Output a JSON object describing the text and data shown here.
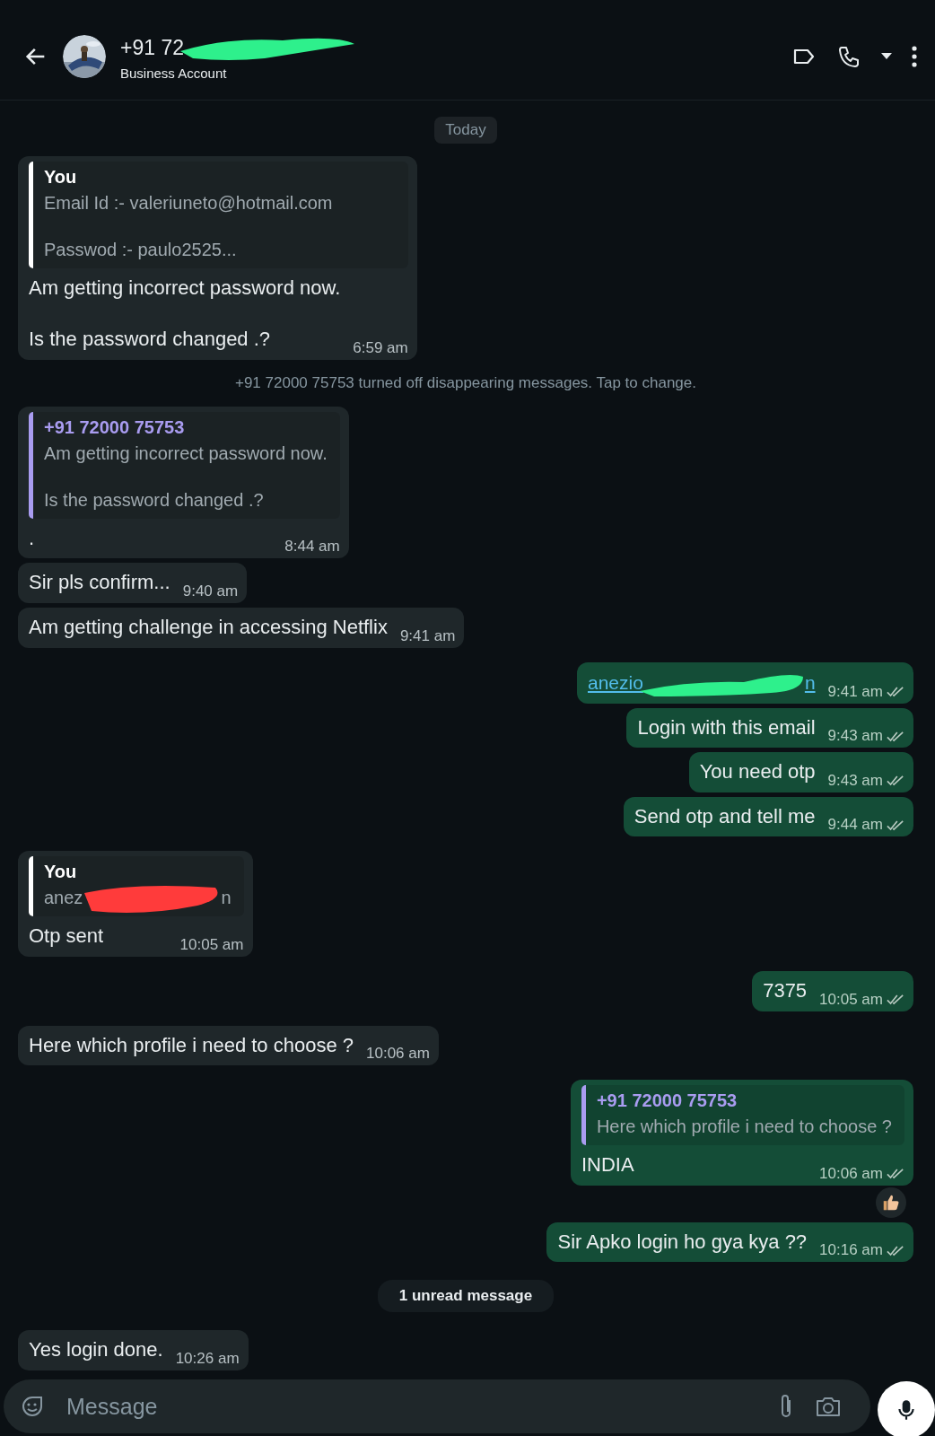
{
  "header": {
    "name_visible": "+91 72",
    "redacted": true,
    "subtitle": "Business Account"
  },
  "items": [
    {
      "kind": "date",
      "text": "Today"
    },
    {
      "kind": "message",
      "outgoing": false,
      "quote": {
        "author": "You",
        "color": "#ffffff",
        "text": "Email Id :- valeriuneto@hotmail.com\n\nPasswod :- paulo2525..."
      },
      "text": "Am getting incorrect password now.\n\nIs the password changed .?",
      "time": "6:59 am"
    },
    {
      "kind": "system",
      "text": "+91 72000 75753 turned off disappearing messages. Tap to change."
    },
    {
      "kind": "message",
      "outgoing": false,
      "quote": {
        "author": "+91 72000 75753",
        "color": "#a99cf0",
        "text": "Am getting incorrect password now.\n\nIs the password changed .?"
      },
      "text": ".",
      "time": "8:44 am"
    },
    {
      "kind": "message",
      "outgoing": false,
      "text": "Sir pls confirm...",
      "time": "9:40 am"
    },
    {
      "kind": "message",
      "outgoing": false,
      "text": "Am getting challenge in accessing Netflix",
      "time": "9:41 am"
    },
    {
      "kind": "message",
      "outgoing": true,
      "link": {
        "start": "anezio",
        "end": "n"
      },
      "time": "9:41 am",
      "read": false
    },
    {
      "kind": "message",
      "outgoing": true,
      "text": "Login with this email",
      "time": "9:43 am",
      "read": false
    },
    {
      "kind": "message",
      "outgoing": true,
      "text": "You need otp",
      "time": "9:43 am",
      "read": false
    },
    {
      "kind": "message",
      "outgoing": true,
      "text": "Send otp and tell me",
      "time": "9:44 am",
      "read": false
    },
    {
      "kind": "message",
      "outgoing": false,
      "quote": {
        "author": "You",
        "color": "#ffffff",
        "text": "anez",
        "redacted_end": "n"
      },
      "text": "Otp sent",
      "time": "10:05 am"
    },
    {
      "kind": "message",
      "outgoing": true,
      "text": "7375",
      "time": "10:05 am",
      "read": false
    },
    {
      "kind": "message",
      "outgoing": false,
      "text": "Here which profile i need to choose ?",
      "time": "10:06 am"
    },
    {
      "kind": "message",
      "outgoing": true,
      "quote": {
        "author": "+91 72000 75753",
        "color": "#a99cf0",
        "text": "Here which profile i need to choose ?"
      },
      "text": "INDIA",
      "time": "10:06 am",
      "read": false,
      "reacted": true
    },
    {
      "kind": "message",
      "outgoing": true,
      "text": "Sir Apko login ho gya kya ??",
      "time": "10:16 am",
      "read": false
    },
    {
      "kind": "unread",
      "text": "1 unread message"
    },
    {
      "kind": "message",
      "outgoing": false,
      "text": "Yes login done.",
      "time": "10:26 am"
    }
  ],
  "composer": {
    "placeholder": "Message"
  }
}
